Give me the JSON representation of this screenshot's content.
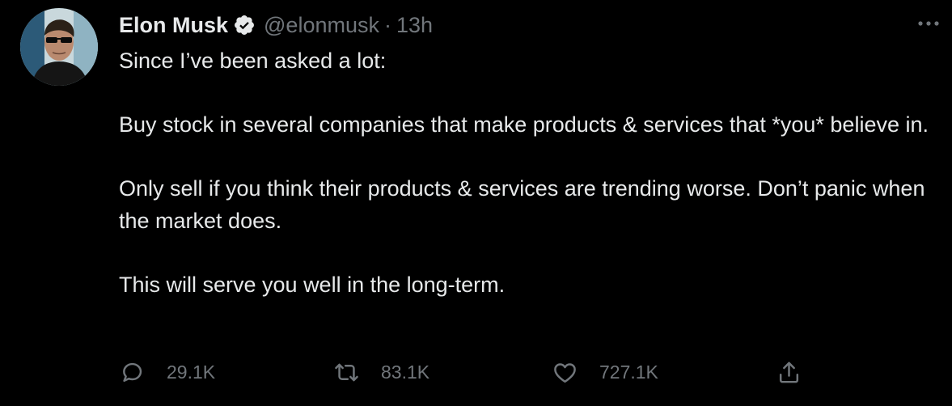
{
  "user": {
    "name": "Elon Musk",
    "handle": "@elonmusk",
    "separator": "·",
    "time": "13h",
    "verified": true
  },
  "tweet": {
    "paragraphs": [
      "Since I’ve been asked a lot:",
      "Buy stock in several companies that make products & services that *you* believe in.",
      "Only sell if you think their products & services are trending worse. Don’t panic when the market does.",
      "This will serve you well in the long-term."
    ]
  },
  "actions": {
    "replies": "29.1K",
    "retweets": "83.1K",
    "likes": "727.1K"
  },
  "icons": {
    "reply": "reply-icon",
    "retweet": "retweet-icon",
    "like": "heart-icon",
    "share": "share-icon",
    "more": "more-icon",
    "verified": "verified-badge-icon"
  },
  "colors": {
    "background": "#000000",
    "text": "#e7e9ea",
    "secondary": "#71767b"
  }
}
